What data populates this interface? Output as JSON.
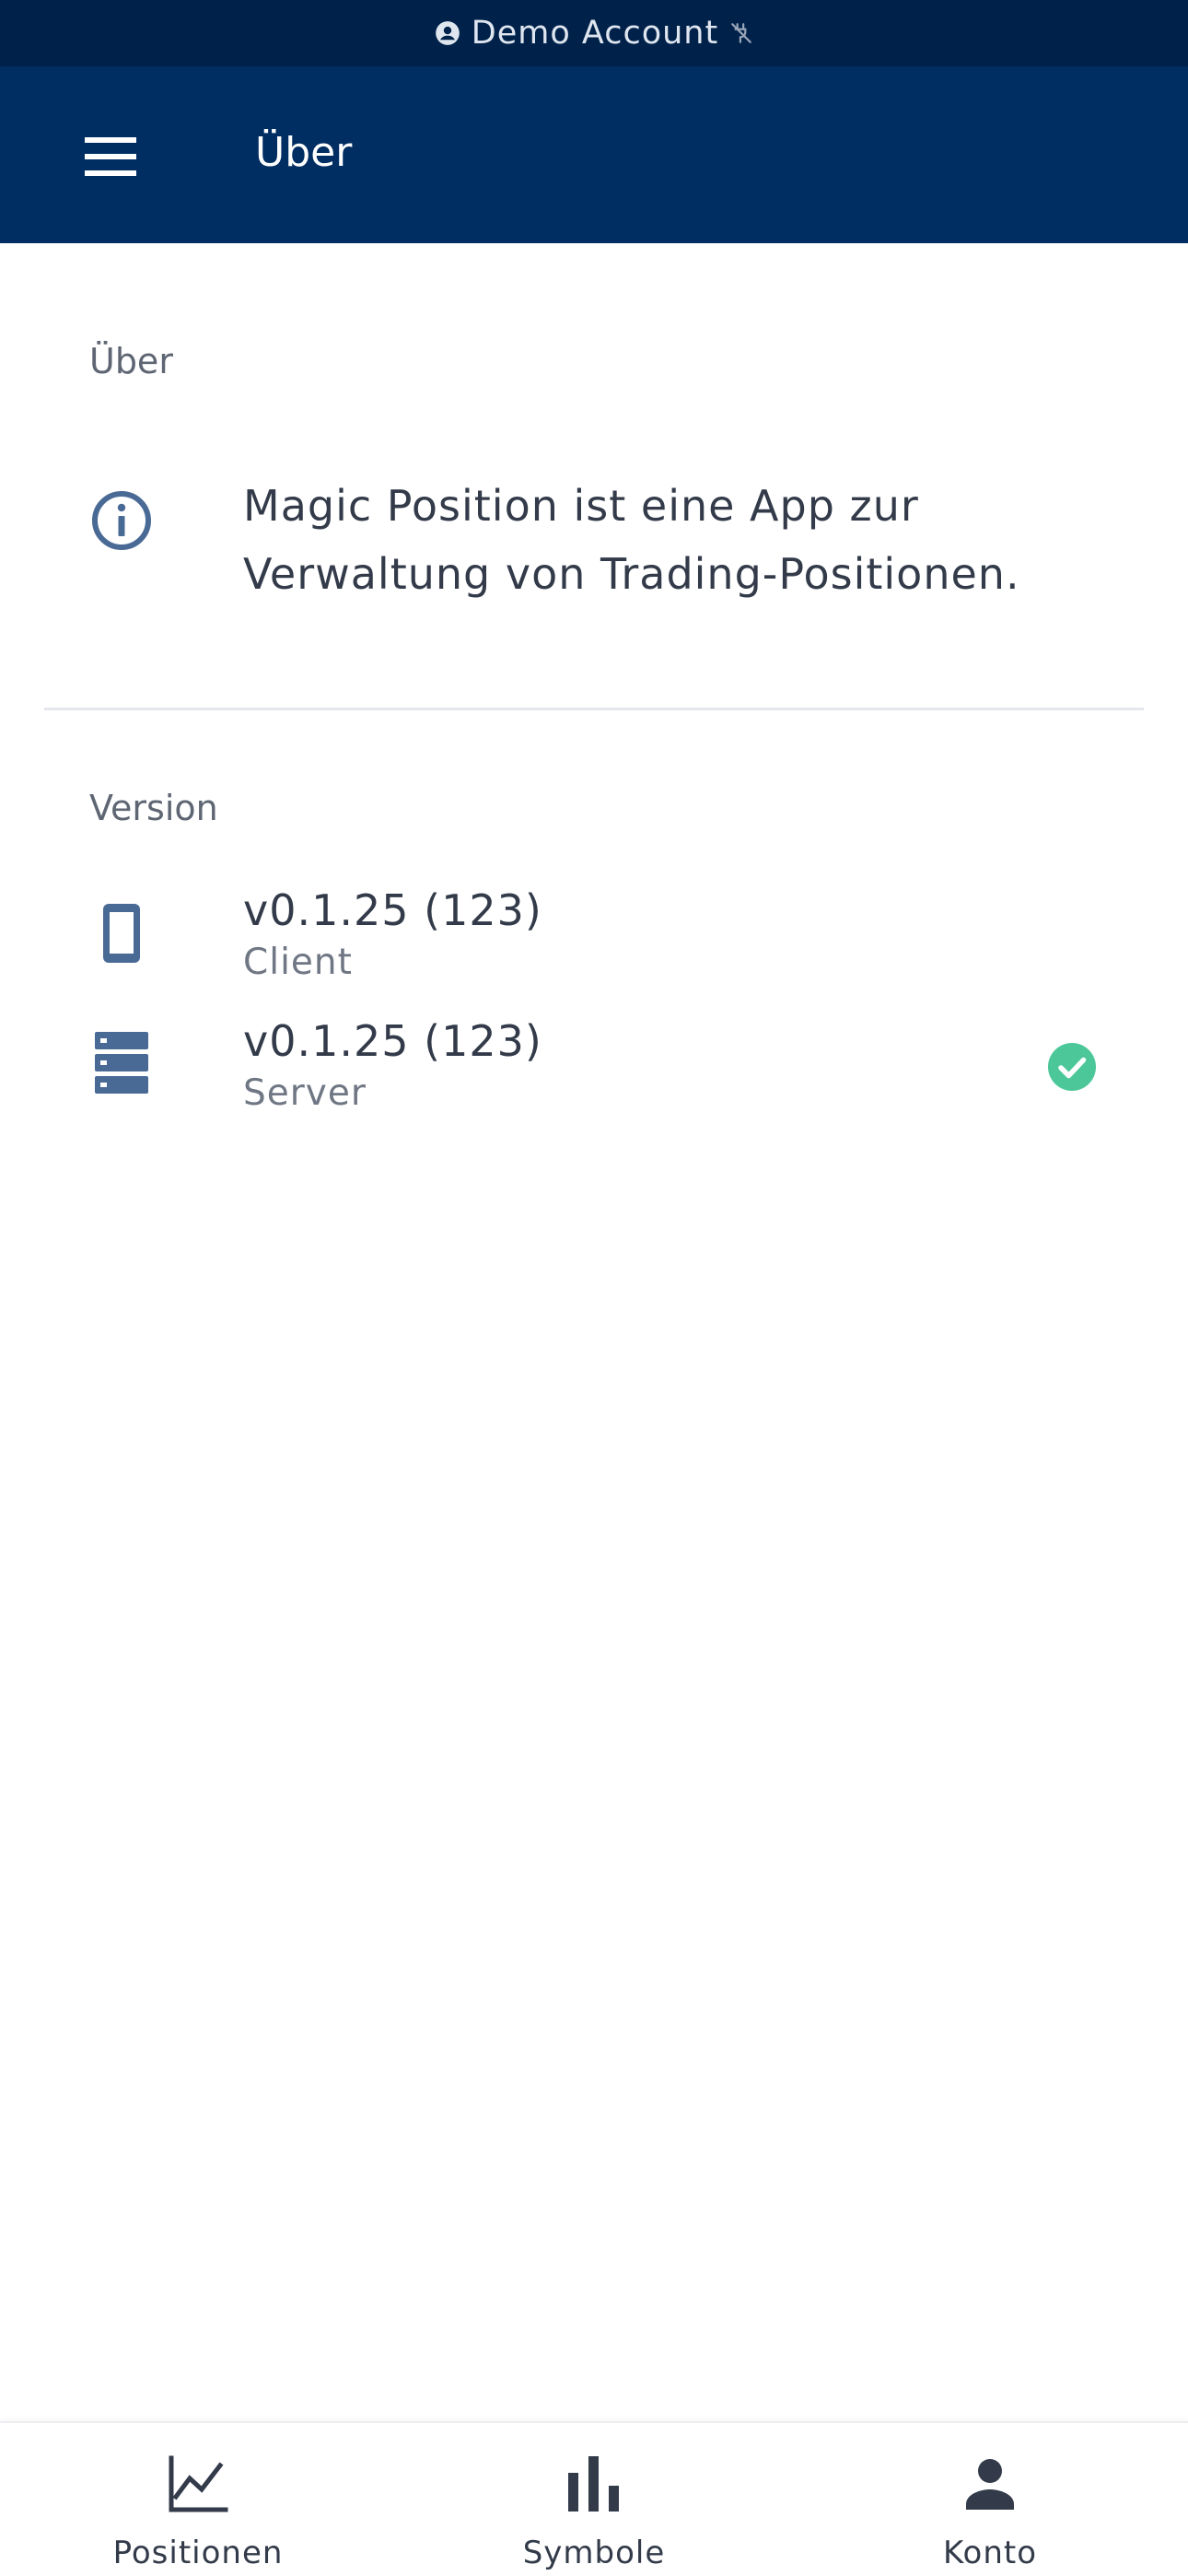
{
  "banner": {
    "label": "Demo Account",
    "user_icon": "account-circle-icon",
    "status_icon": "disconnected-icon"
  },
  "app_bar": {
    "menu_icon": "menu-icon",
    "title": "Über"
  },
  "about": {
    "header": "Über",
    "icon": "info-icon",
    "text": "Magic Position ist eine App zur Verwaltung von Trading-Positionen."
  },
  "version": {
    "header": "Version",
    "items": [
      {
        "icon": "phone-icon",
        "value": "v0.1.25 (123)",
        "label": "Client"
      },
      {
        "icon": "server-icon",
        "value": "v0.1.25 (123)",
        "label": "Server",
        "status_icon": "check-circle-icon"
      }
    ]
  },
  "bottom_nav": {
    "items": [
      {
        "icon": "chart-line-icon",
        "label": "Positionen"
      },
      {
        "icon": "bar-chart-icon",
        "label": "Symbole"
      },
      {
        "icon": "person-icon",
        "label": "Konto"
      }
    ]
  },
  "colors": {
    "banner_bg": "#00224a",
    "app_bar_bg": "#002d62",
    "icon_blue": "#4a6a96",
    "success_green": "#4cc79a",
    "text_primary": "#333b4a",
    "text_secondary": "#707784"
  }
}
